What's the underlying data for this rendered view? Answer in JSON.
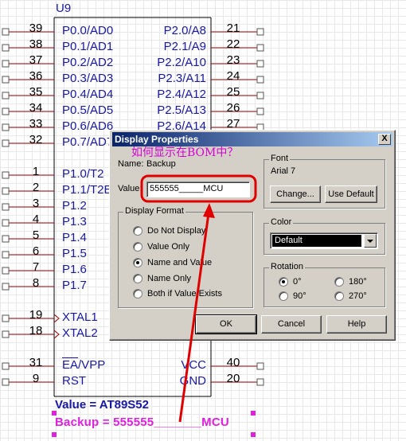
{
  "schematic": {
    "chip_name": "U9",
    "left_pins": [
      {
        "num": "39",
        "name": "P0.0/AD0"
      },
      {
        "num": "38",
        "name": "P0.1/AD1"
      },
      {
        "num": "37",
        "name": "P0.2/AD2"
      },
      {
        "num": "36",
        "name": "P0.3/AD3"
      },
      {
        "num": "35",
        "name": "P0.4/AD4"
      },
      {
        "num": "34",
        "name": "P0.5/AD5"
      },
      {
        "num": "33",
        "name": "P0.6/AD6"
      },
      {
        "num": "32",
        "name": "P0.7/AD7"
      },
      {
        "num": "1",
        "name": "P1.0/T2"
      },
      {
        "num": "2",
        "name": "P1.1/T2EX"
      },
      {
        "num": "3",
        "name": "P1.2"
      },
      {
        "num": "4",
        "name": "P1.3"
      },
      {
        "num": "5",
        "name": "P1.4"
      },
      {
        "num": "6",
        "name": "P1.5"
      },
      {
        "num": "7",
        "name": "P1.6"
      },
      {
        "num": "8",
        "name": "P1.7"
      },
      {
        "num": "19",
        "name": "XTAL1"
      },
      {
        "num": "18",
        "name": "XTAL2"
      },
      {
        "num": "31",
        "name": "EA/VPP"
      },
      {
        "num": "9",
        "name": "RST"
      }
    ],
    "right_pins": [
      {
        "num": "21",
        "name": "P2.0/A8"
      },
      {
        "num": "22",
        "name": "P2.1/A9"
      },
      {
        "num": "23",
        "name": "P2.2/A10"
      },
      {
        "num": "24",
        "name": "P2.3/A11"
      },
      {
        "num": "25",
        "name": "P2.4/A12"
      },
      {
        "num": "26",
        "name": "P2.5/A13"
      },
      {
        "num": "27",
        "name": "P2.6/A14"
      },
      {
        "num": "40",
        "name": "VCC"
      },
      {
        "num": "20",
        "name": "GND"
      }
    ],
    "value_label": "Value = AT89S52",
    "backup_label": "Backup = 555555_______MCU"
  },
  "annotation": "如何显示在BOM中？",
  "dialog": {
    "title": "Display Properties",
    "close_label": "X",
    "name_label": "Name:",
    "name_value": "Backup",
    "value_label": "Value:",
    "value_text": "555555_____MCU",
    "display_format": {
      "title": "Display Format",
      "options": [
        "Do Not Display",
        "Value Only",
        "Name and Value",
        "Name Only",
        "Both if Value Exists"
      ],
      "selected": "Name and Value"
    },
    "font": {
      "title": "Font",
      "current": "Arial 7",
      "change_label": "Change...",
      "use_default_label": "Use Default"
    },
    "color": {
      "title": "Color",
      "selected": "Default"
    },
    "rotation": {
      "title": "Rotation",
      "options": [
        "0°",
        "90°",
        "180°",
        "270°"
      ],
      "selected": "0°"
    },
    "buttons": {
      "ok": "OK",
      "cancel": "Cancel",
      "help": "Help"
    }
  },
  "colors": {
    "pin_label": "#1818a8",
    "backup_label": "#e020e0",
    "wire": "#a00000",
    "highlight": "#e00000",
    "title_bar": "#0a246a"
  }
}
